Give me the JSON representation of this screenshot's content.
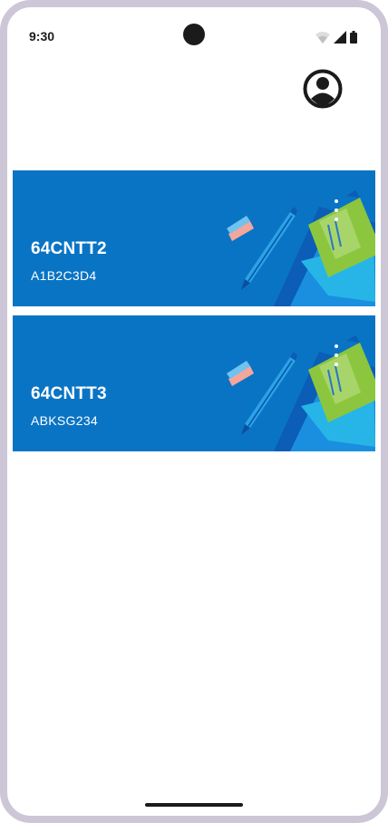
{
  "status_bar": {
    "time": "9:30"
  },
  "header": {
    "profile_icon": "account-circle-icon"
  },
  "classes": [
    {
      "name": "64CNTT2",
      "code": "A1B2C3D4",
      "menu_icon": "more-vert-icon"
    },
    {
      "name": "64CNTT3",
      "code": "ABKSG234",
      "menu_icon": "more-vert-icon"
    }
  ],
  "colors": {
    "card_background": "#0a74c4",
    "frame": "#cdc6d6",
    "text_on_card": "#ffffff"
  }
}
